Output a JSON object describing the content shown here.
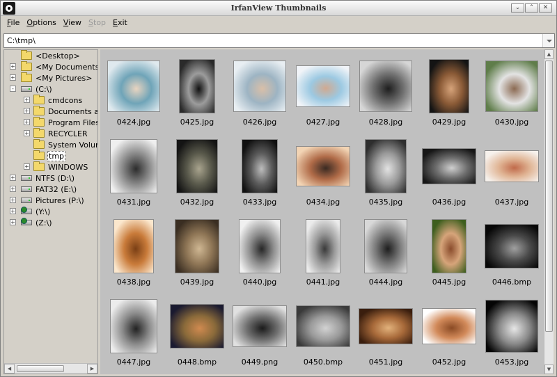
{
  "window": {
    "title": "IrfanView Thumbnails"
  },
  "window_controls": [
    "⌄",
    "⌃",
    "✕"
  ],
  "menu": [
    {
      "label": "File",
      "ul": "F",
      "rest": "ile",
      "disabled": false
    },
    {
      "label": "Options",
      "ul": "O",
      "rest": "ptions",
      "disabled": false
    },
    {
      "label": "View",
      "ul": "V",
      "rest": "iew",
      "disabled": false
    },
    {
      "label": "Stop",
      "ul": "S",
      "rest": "top",
      "disabled": true
    },
    {
      "label": "Exit",
      "ul": "E",
      "rest": "xit",
      "disabled": false
    }
  ],
  "path": {
    "value": "C:\\tmp\\"
  },
  "tree": [
    {
      "label": "<Desktop>",
      "icon": "folder-icon",
      "level": 0,
      "expander": ""
    },
    {
      "label": "<My Documents>",
      "icon": "folder-icon",
      "level": 0,
      "expander": "+"
    },
    {
      "label": "<My Pictures>",
      "icon": "folder-icon",
      "level": 0,
      "expander": "+"
    },
    {
      "label": "(C:\\)",
      "icon": "drive-icon",
      "level": 0,
      "expander": "-"
    },
    {
      "label": "cmdcons",
      "icon": "folder-icon",
      "level": 1,
      "expander": "+"
    },
    {
      "label": "Documents and",
      "icon": "folder-icon",
      "level": 1,
      "expander": "+"
    },
    {
      "label": "Program Files",
      "icon": "folder-icon",
      "level": 1,
      "expander": "+"
    },
    {
      "label": "RECYCLER",
      "icon": "folder-icon",
      "level": 1,
      "expander": "+"
    },
    {
      "label": "System Volume",
      "icon": "folder-icon",
      "level": 1,
      "expander": ""
    },
    {
      "label": "tmp",
      "icon": "folder-icon",
      "level": 1,
      "expander": "",
      "selected": true
    },
    {
      "label": "WINDOWS",
      "icon": "folder-icon",
      "level": 1,
      "expander": "+"
    },
    {
      "label": "NTFS (D:\\)",
      "icon": "drive-icon",
      "level": 0,
      "expander": "+"
    },
    {
      "label": "FAT32 (E:\\)",
      "icon": "drive-icon",
      "level": 0,
      "expander": "+"
    },
    {
      "label": "Pictures (P:\\)",
      "icon": "drive-icon",
      "level": 0,
      "expander": "+"
    },
    {
      "label": "(Y:\\)",
      "icon": "network-drive-icon",
      "level": 0,
      "expander": "+"
    },
    {
      "label": "(Z:\\)",
      "icon": "network-drive-icon",
      "level": 0,
      "expander": "+"
    }
  ],
  "thumbnails": [
    {
      "name": "0424.jpg",
      "w": 76,
      "h": 74,
      "colors": [
        "#dfe9ee",
        "#6fa4b8",
        "#e9d4c0"
      ]
    },
    {
      "name": "0425.jpg",
      "w": 52,
      "h": 78,
      "colors": [
        "#2a2a2a",
        "#9c9c9c",
        "#111111"
      ]
    },
    {
      "name": "0426.jpg",
      "w": 76,
      "h": 74,
      "colors": [
        "#e8eef2",
        "#9db4c3",
        "#d9bfa8"
      ]
    },
    {
      "name": "0427.jpg",
      "w": 78,
      "h": 60,
      "colors": [
        "#f1f4f8",
        "#9cc9e2",
        "#d1a990"
      ]
    },
    {
      "name": "0428.jpg",
      "w": 76,
      "h": 74,
      "colors": [
        "#d6d6d6",
        "#707070",
        "#1e1e1e"
      ]
    },
    {
      "name": "0429.jpg",
      "w": 58,
      "h": 78,
      "colors": [
        "#141414",
        "#8a5a36",
        "#d6a37a"
      ]
    },
    {
      "name": "0430.jpg",
      "w": 76,
      "h": 74,
      "colors": [
        "#5f7d4a",
        "#e3e3e3",
        "#8b6a52"
      ]
    },
    {
      "name": "0431.jpg",
      "w": 68,
      "h": 78,
      "colors": [
        "#efefef",
        "#8a8a8a",
        "#2c2c2c"
      ]
    },
    {
      "name": "0432.jpg",
      "w": 60,
      "h": 78,
      "colors": [
        "#141414",
        "#5a5a4c",
        "#a9a48e"
      ]
    },
    {
      "name": "0433.jpg",
      "w": 52,
      "h": 78,
      "colors": [
        "#101010",
        "#5c5c5c",
        "#bdbdbd"
      ]
    },
    {
      "name": "0434.jpg",
      "w": 78,
      "h": 58,
      "colors": [
        "#f2d4b4",
        "#b06b48",
        "#3a2a22"
      ]
    },
    {
      "name": "0435.jpg",
      "w": 60,
      "h": 78,
      "colors": [
        "#2e2e2e",
        "#9a9a9a",
        "#e2e2e2"
      ]
    },
    {
      "name": "0436.jpg",
      "w": 78,
      "h": 52,
      "colors": [
        "#161616",
        "#6d6d6d",
        "#cfcfcf"
      ]
    },
    {
      "name": "0437.jpg",
      "w": 78,
      "h": 46,
      "colors": [
        "#f6f1ec",
        "#e0b494",
        "#c06a4a"
      ]
    },
    {
      "name": "0438.jpg",
      "w": 58,
      "h": 78,
      "colors": [
        "#fbe7cd",
        "#c97b3a",
        "#7a3f15"
      ]
    },
    {
      "name": "0439.jpg",
      "w": 64,
      "h": 78,
      "colors": [
        "#3a2e22",
        "#8f7656",
        "#cfb793"
      ]
    },
    {
      "name": "0440.jpg",
      "w": 60,
      "h": 78,
      "colors": [
        "#f0f0f0",
        "#8e8e8e",
        "#262626"
      ]
    },
    {
      "name": "0441.jpg",
      "w": 50,
      "h": 78,
      "colors": [
        "#ebebeb",
        "#9a9a9a",
        "#3a3a3a"
      ]
    },
    {
      "name": "0444.jpg",
      "w": 62,
      "h": 78,
      "colors": [
        "#d8d8d8",
        "#7a7a7a",
        "#1e1e1e"
      ]
    },
    {
      "name": "0445.jpg",
      "w": 50,
      "h": 78,
      "colors": [
        "#3d5e1e",
        "#d6a47a",
        "#8a4c2c"
      ]
    },
    {
      "name": "0446.bmp",
      "w": 78,
      "h": 64,
      "colors": [
        "#070707",
        "#4a4a4a",
        "#a0a0a0"
      ]
    },
    {
      "name": "0447.jpg",
      "w": 68,
      "h": 78,
      "colors": [
        "#ececec",
        "#8c8c8c",
        "#222222"
      ]
    },
    {
      "name": "0448.bmp",
      "w": 78,
      "h": 64,
      "colors": [
        "#1a1a30",
        "#8a6a3a",
        "#d08a50"
      ]
    },
    {
      "name": "0449.png",
      "w": 78,
      "h": 60,
      "colors": [
        "#e0e0e0",
        "#707070",
        "#1a1a1a"
      ]
    },
    {
      "name": "0450.bmp",
      "w": 78,
      "h": 60,
      "colors": [
        "#3a3a3a",
        "#9a9a9a",
        "#d2d2d2"
      ]
    },
    {
      "name": "0451.jpg",
      "w": 78,
      "h": 52,
      "colors": [
        "#3a1e0e",
        "#a86a3a",
        "#e2b27c"
      ]
    },
    {
      "name": "0452.jpg",
      "w": 78,
      "h": 52,
      "colors": [
        "#ffffff",
        "#d28a5a",
        "#8a4a24"
      ]
    },
    {
      "name": "0453.jpg",
      "w": 76,
      "h": 76,
      "colors": [
        "#050505",
        "#8a8a8a",
        "#e6e6e6"
      ]
    }
  ]
}
